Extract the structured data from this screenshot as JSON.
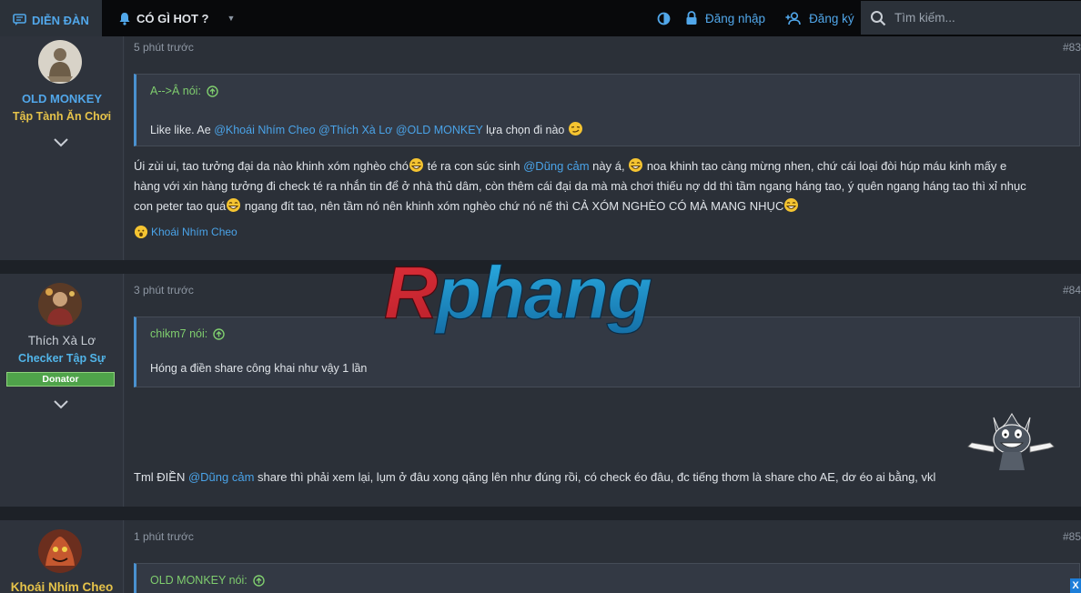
{
  "nav": {
    "forum_label": "DIỄN ĐÀN",
    "hot_label": "CÓ GÌ HOT ?",
    "login_label": "Đăng nhập",
    "register_label": "Đăng ký",
    "search_placeholder": "Tìm kiếm..."
  },
  "posts": [
    {
      "user": {
        "name": "OLD MONKEY",
        "title": "Tập Tành Ăn Chơi"
      },
      "time": "5 phút trước",
      "number": "#83",
      "quote": {
        "author": "A-->Â nói:",
        "text_before": "Like like. Ae ",
        "mentions": [
          "@Khoái Nhím Cheo",
          "@Thích Xà Lơ",
          "@OLD MONKEY"
        ],
        "text_after": " lựa chọn đi nào"
      },
      "body": {
        "line1_a": "Úi zùi ui, tao tưởng đại da nào khinh xóm nghèo chó",
        "line1_b": " té ra con súc sinh ",
        "line1_mention": "@Dũng cảm",
        "line1_c": " này á, ",
        "line1_d": " noa khinh tao càng mừng nhen, chứ cái loại đòi húp máu kinh mấy e",
        "line2": "hàng với xin hàng tưởng đi check té ra nhắn tin để ở nhà thủ dâm, còn thêm cái đại da mà mà chơi thiếu nợ dd thì tầm ngang háng tao, ý quên ngang háng tao thì xỉ nhục",
        "line3_a": "con peter tao quá",
        "line3_b": " ngang đít tao, nên tầm nó nên khinh xóm nghèo chứ nó nế thì CẢ XÓM NGHÈO CÓ MÀ MANG NHỤC"
      },
      "reaction_user": "Khoái Nhím Cheo"
    },
    {
      "user": {
        "name": "Thích Xà Lơ",
        "title": "Checker Tập Sự",
        "badge": "Donator"
      },
      "time": "3 phút trước",
      "number": "#84",
      "quote": {
        "author": "chikm7 nói:",
        "text": "Hóng a điền share công khai như vậy 1 lần"
      },
      "body": {
        "text_a": "Tml ĐIỀN ",
        "mention": "@Dũng cảm",
        "text_b": " share thì phải xem lại, lụm ở đâu xong qăng lên như đúng rồi, có check éo đâu, đc tiếng thơm là share cho AE, dơ éo ai bằng, vkl"
      }
    },
    {
      "user": {
        "name": "Khoái Nhím Cheo"
      },
      "time": "1 phút trước",
      "number": "#85",
      "quote": {
        "author": "OLD MONKEY nói:"
      }
    }
  ],
  "watermark": "Rphang",
  "close_label": "X",
  "colors": {
    "accent": "#51a7ea",
    "quote_author": "#7fcd6e",
    "donator": "#4fa34a"
  }
}
